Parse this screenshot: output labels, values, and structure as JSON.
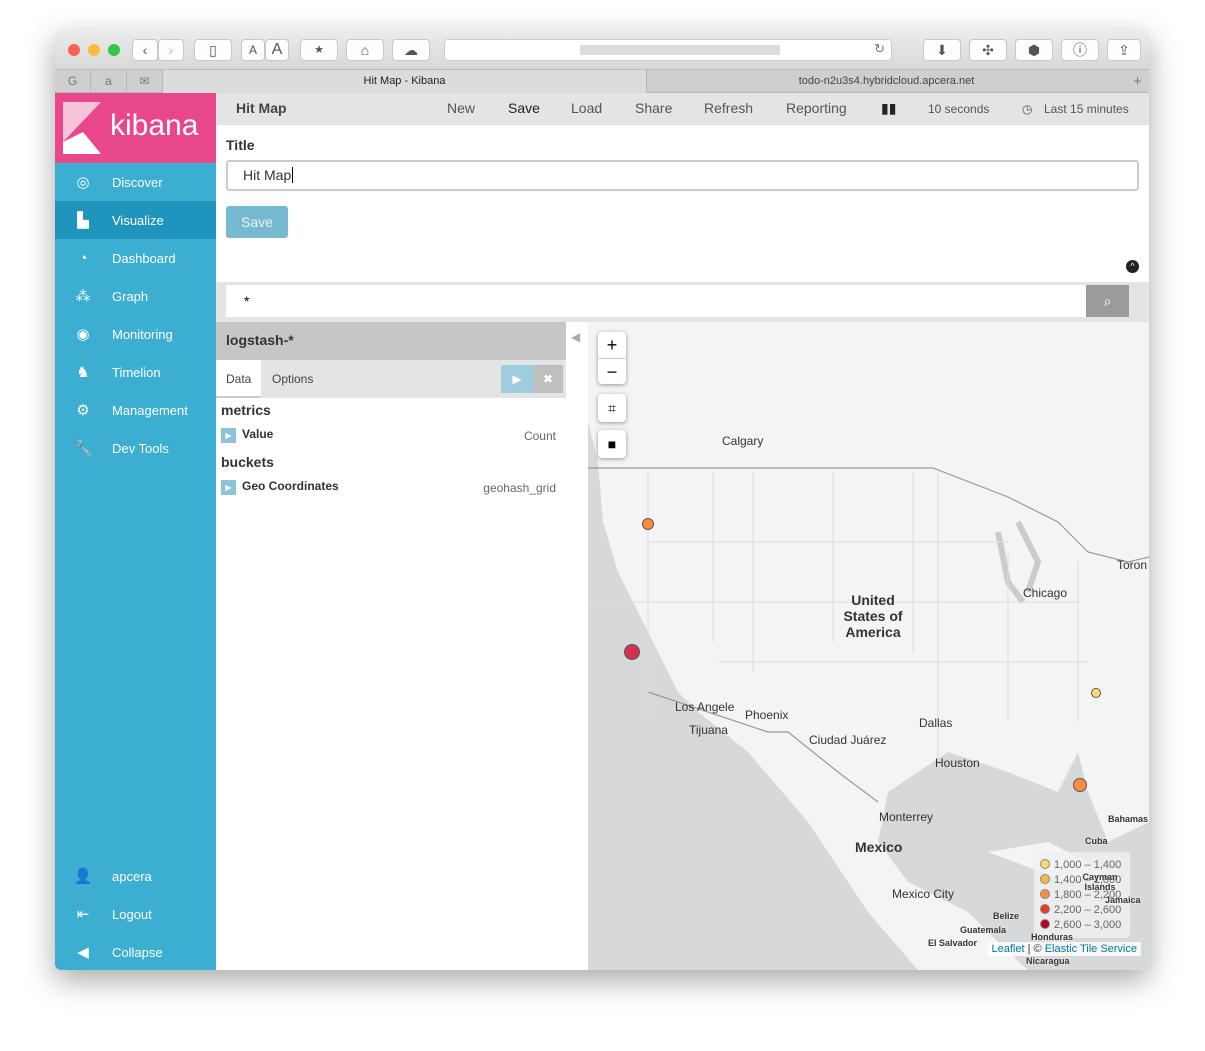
{
  "browser": {
    "tab_active": "Hit Map - Kibana",
    "tab_other": "todo-n2u3s4.hybridcloud.apcera.net",
    "font_small": "A",
    "font_large": "A",
    "favorites": [
      "G",
      "a",
      "✉"
    ]
  },
  "sidebar": {
    "logo": "kibana",
    "items": [
      {
        "label": "Discover",
        "icon": "compass-icon"
      },
      {
        "label": "Visualize",
        "icon": "bar-chart-icon"
      },
      {
        "label": "Dashboard",
        "icon": "dashboard-icon"
      },
      {
        "label": "Graph",
        "icon": "graph-icon"
      },
      {
        "label": "Monitoring",
        "icon": "eye-icon"
      },
      {
        "label": "Timelion",
        "icon": "timelion-icon"
      },
      {
        "label": "Management",
        "icon": "gear-icon"
      },
      {
        "label": "Dev Tools",
        "icon": "wrench-icon"
      }
    ],
    "bottom": [
      {
        "label": "apcera",
        "icon": "user-icon"
      },
      {
        "label": "Logout",
        "icon": "logout-icon"
      },
      {
        "label": "Collapse",
        "icon": "collapse-icon"
      }
    ]
  },
  "header": {
    "title": "Hit Map",
    "menu": [
      "New",
      "Save",
      "Load",
      "Share",
      "Refresh",
      "Reporting"
    ],
    "interval": "10 seconds",
    "timerange": "Last 15 minutes"
  },
  "save_form": {
    "title_label": "Title",
    "title_value": "Hit Map",
    "save_label": "Save"
  },
  "query": {
    "value": "*"
  },
  "editor": {
    "index": "logstash-*",
    "tabs": [
      "Data",
      "Options"
    ],
    "metrics_heading": "metrics",
    "metric": {
      "label": "Value",
      "agg": "Count"
    },
    "buckets_heading": "buckets",
    "bucket": {
      "label": "Geo Coordinates",
      "agg": "geohash_grid"
    }
  },
  "map": {
    "zoom_in": "+",
    "zoom_out": "−",
    "labels": [
      "Calgary",
      "Chicago",
      "Toron",
      "United States of America",
      "Los Angele",
      "Phoenix",
      "Tijuana",
      "Dallas",
      "Ciudad Juárez",
      "Houston",
      "Monterrey",
      "Mexico",
      "Mexico City",
      "Bahamas",
      "Cuba",
      "Cayman Islands",
      "Jamaica",
      "Belize",
      "Guatemala",
      "Honduras",
      "El Salvador",
      "Nicaragua"
    ],
    "legend": [
      {
        "range": "1,000 – 1,400",
        "color": "#fed976"
      },
      {
        "range": "1,400 – 1,800",
        "color": "#feb24c"
      },
      {
        "range": "1,800 – 2,200",
        "color": "#fd8d3c"
      },
      {
        "range": "2,200 – 2,600",
        "color": "#f03b20"
      },
      {
        "range": "2,600 – 3,000",
        "color": "#bd0026"
      }
    ],
    "attribution": {
      "leaflet": "Leaflet",
      "sep": " | © ",
      "service": "Elastic Tile Service"
    }
  }
}
